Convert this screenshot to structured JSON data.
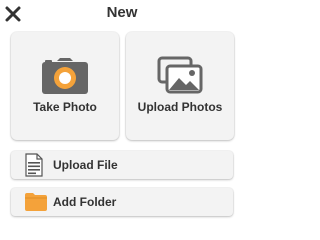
{
  "header": {
    "title": "New",
    "close_icon": "close-x-icon"
  },
  "cards": {
    "take_photo": {
      "label": "Take Photo",
      "icon": "camera-icon"
    },
    "upload_photos": {
      "label": "Upload Photos",
      "icon": "photos-icon"
    }
  },
  "rows": {
    "upload_file": {
      "label": "Upload File",
      "icon": "document-icon"
    },
    "add_folder": {
      "label": "Add Folder",
      "icon": "folder-icon"
    }
  },
  "colors": {
    "accent_orange": "#f4a23a",
    "icon_gray": "#666666",
    "card_bg": "#f3f3f3",
    "text": "#333333"
  }
}
